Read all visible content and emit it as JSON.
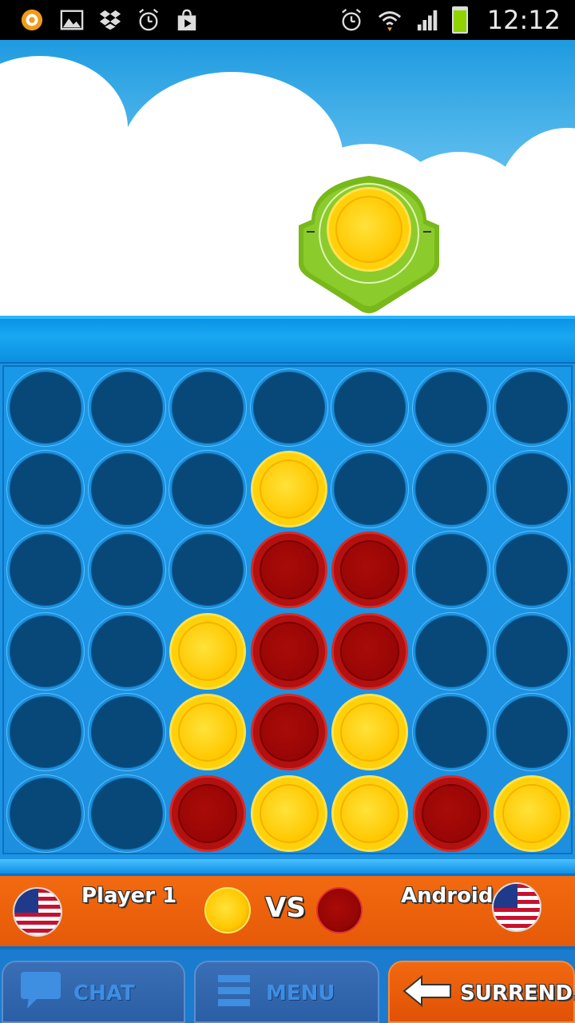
{
  "status_bar": {
    "time": "12:12",
    "left_icons": [
      "app-icon",
      "image-icon",
      "dropbox-icon",
      "alarm-clock-icon",
      "play-store-icon"
    ],
    "right_icons": [
      "alarm-icon",
      "wifi-icon",
      "signal-icon",
      "battery-icon"
    ],
    "battery_color": "#8fd400"
  },
  "game": {
    "current_turn_color": "yellow",
    "board": {
      "columns": 7,
      "rows": 6,
      "grid": [
        [
          "empty",
          "empty",
          "empty",
          "empty",
          "empty",
          "empty",
          "empty"
        ],
        [
          "empty",
          "empty",
          "empty",
          "yellow",
          "empty",
          "empty",
          "empty"
        ],
        [
          "empty",
          "empty",
          "empty",
          "red",
          "red",
          "empty",
          "empty"
        ],
        [
          "empty",
          "empty",
          "yellow",
          "red",
          "red",
          "empty",
          "empty"
        ],
        [
          "empty",
          "empty",
          "yellow",
          "red",
          "yellow",
          "empty",
          "empty"
        ],
        [
          "empty",
          "empty",
          "red",
          "yellow",
          "yellow",
          "red",
          "yellow"
        ]
      ]
    }
  },
  "players": {
    "left": {
      "name": "Player 1",
      "flag": "us-flag-icon",
      "chip_color": "yellow"
    },
    "vs_label": "VS",
    "right": {
      "name": "Android",
      "flag": "us-flag-icon",
      "chip_color": "red"
    }
  },
  "buttons": {
    "chat": {
      "label": "CHAT",
      "icon": "chat-bubble-icon"
    },
    "menu": {
      "label": "MENU",
      "icon": "menu-lines-icon"
    },
    "surrender": {
      "label": "SURREND..",
      "icon": "arrow-left-icon"
    }
  },
  "colors": {
    "board_blue": "#1d93e3",
    "empty_hole": "#074878",
    "yellow_chip": "#ffc800",
    "red_chip": "#980605",
    "info_bar": "#f26a10"
  }
}
